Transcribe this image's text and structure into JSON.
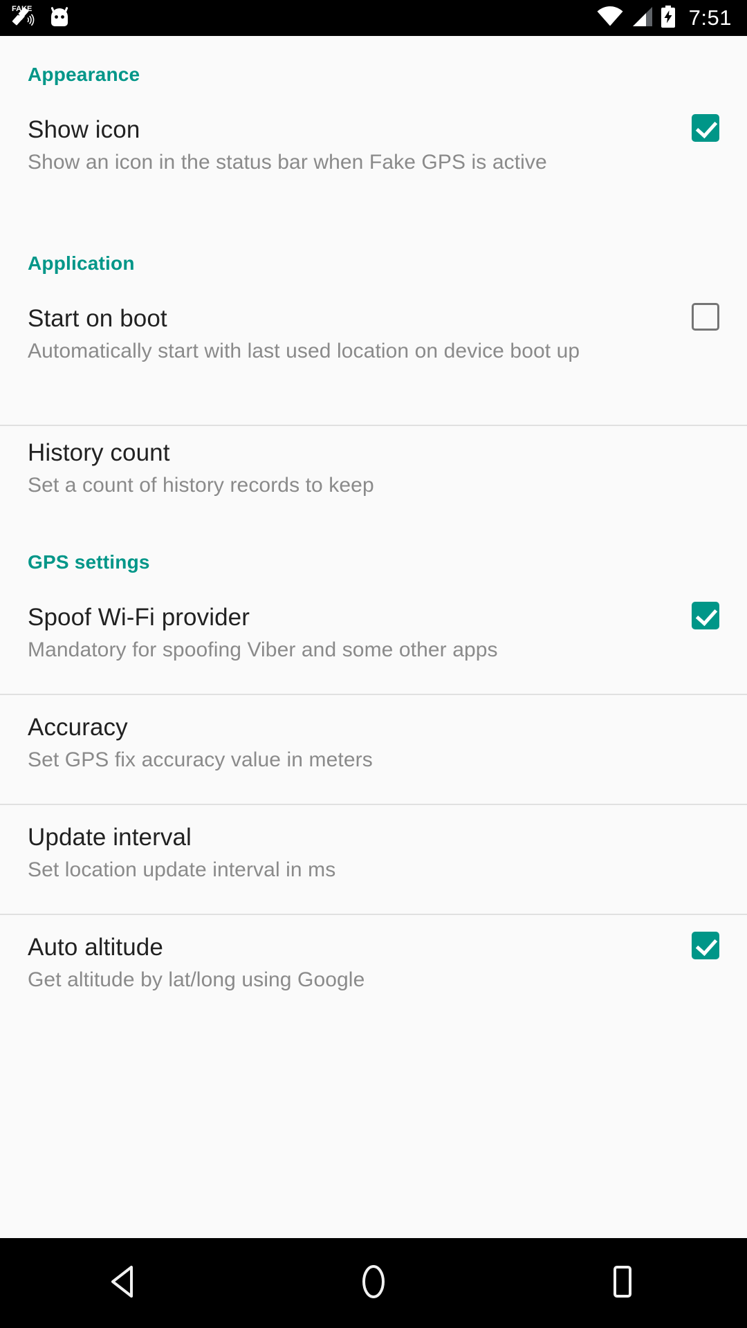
{
  "status_bar": {
    "time": "7:51",
    "left_icons": [
      "fake-gps-satellite-icon",
      "android-head-icon"
    ],
    "right_icons": [
      "wifi-icon",
      "cellular-signal-icon",
      "battery-charging-icon"
    ],
    "background_color": "#000000",
    "foreground_color": "#ffffff"
  },
  "theme": {
    "accent_color": "#009688",
    "page_background": "#fafafa",
    "title_color": "#212121",
    "summary_color": "#8a8a8a",
    "divider_color": "#e0e0e0"
  },
  "sections": [
    {
      "header": "Appearance",
      "items": [
        {
          "title": "Show icon",
          "summary": "Show an icon in the status bar when Fake GPS is active",
          "widget": "checkbox",
          "checked": true
        }
      ]
    },
    {
      "header": "Application",
      "items": [
        {
          "title": "Start on boot",
          "summary": "Automatically start with last used location on device boot up",
          "widget": "checkbox",
          "checked": false
        },
        {
          "title": "History count",
          "summary": "Set a count of history records to keep",
          "widget": "none",
          "checked": null
        }
      ]
    },
    {
      "header": "GPS settings",
      "items": [
        {
          "title": "Spoof Wi-Fi provider",
          "summary": "Mandatory for spoofing Viber and some other apps",
          "widget": "checkbox",
          "checked": true
        },
        {
          "title": "Accuracy",
          "summary": "Set GPS fix accuracy value in meters",
          "widget": "none",
          "checked": null
        },
        {
          "title": "Update interval",
          "summary": "Set location update interval in ms",
          "widget": "none",
          "checked": null
        },
        {
          "title": "Auto altitude",
          "summary": "Get altitude by lat/long using Google",
          "widget": "checkbox",
          "checked": true
        }
      ]
    }
  ],
  "nav_bar": {
    "buttons": [
      {
        "name": "back-button",
        "icon": "back-triangle-icon"
      },
      {
        "name": "home-button",
        "icon": "home-circle-icon"
      },
      {
        "name": "recents-button",
        "icon": "recents-square-icon"
      }
    ],
    "background_color": "#000000"
  }
}
